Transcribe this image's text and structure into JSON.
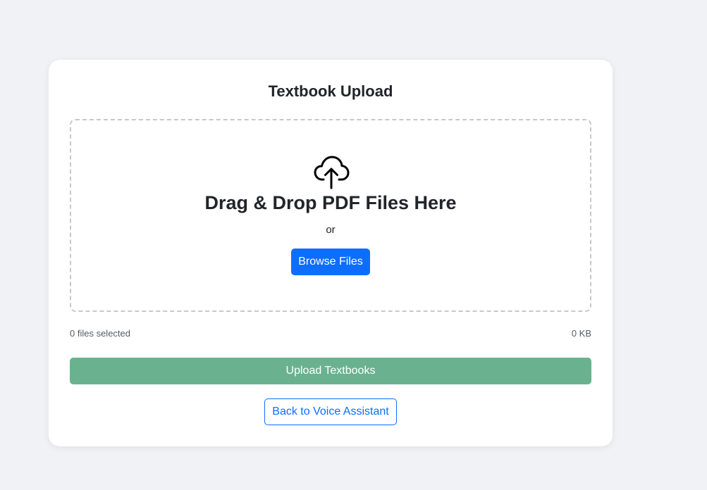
{
  "title": "Textbook Upload",
  "dropzone": {
    "icon": "cloud-upload-icon",
    "heading": "Drag & Drop PDF Files Here",
    "or_text": "or",
    "browse_label": "Browse Files"
  },
  "file_info": {
    "count_text": "0 files selected",
    "size_text": "0 KB"
  },
  "actions": {
    "upload_label": "Upload Textbooks",
    "back_label": "Back to Voice Assistant"
  },
  "colors": {
    "background": "#f0f2f5",
    "primary": "#0d6efd",
    "upload_disabled": "#6ab28f",
    "text": "#212529"
  }
}
